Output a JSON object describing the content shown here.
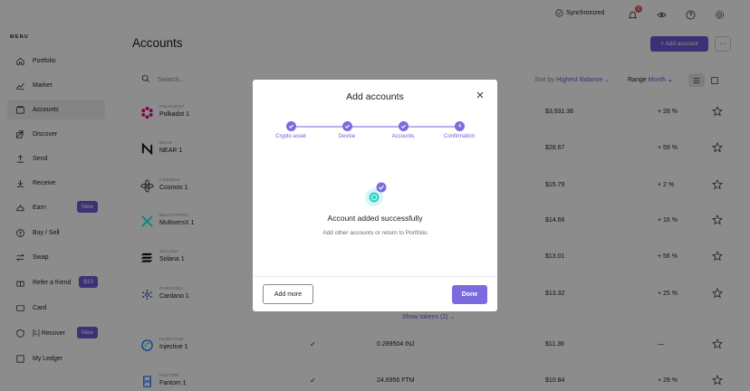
{
  "sidebar": {
    "menu_label": "MENU",
    "items": [
      {
        "label": "Portfolio",
        "icon": "portfolio-icon"
      },
      {
        "label": "Market",
        "icon": "market-icon"
      },
      {
        "label": "Accounts",
        "icon": "accounts-icon",
        "active": true
      },
      {
        "label": "Discover",
        "icon": "discover-icon"
      },
      {
        "label": "Send",
        "icon": "send-icon"
      },
      {
        "label": "Receive",
        "icon": "receive-icon"
      },
      {
        "label": "Earn",
        "icon": "earn-icon",
        "badge": "New"
      },
      {
        "label": "Buy / Sell",
        "icon": "buy-sell-icon"
      },
      {
        "label": "Swap",
        "icon": "swap-icon"
      },
      {
        "label": "Refer a friend",
        "icon": "refer-icon",
        "badge": "$10"
      },
      {
        "label": "Card",
        "icon": "card-icon"
      },
      {
        "label": "[L] Recover",
        "icon": "recover-icon",
        "badge": "New"
      },
      {
        "label": "My Ledger",
        "icon": "ledger-icon"
      }
    ]
  },
  "topbar": {
    "sync_label": "Synchronized",
    "notification_count": "1"
  },
  "main": {
    "title": "Accounts",
    "add_account_label": "+ Add account",
    "more_label": "···",
    "search_placeholder": "Search...",
    "sort_label": "Sort by",
    "sort_value": "Highest Balance",
    "range_label": "Range",
    "range_value": "Month",
    "show_tokens_label": "Show tokens (2) ⌄"
  },
  "accounts": [
    {
      "network": "POLKADOT",
      "name": "Polkadot 1",
      "fiat": "$3,931.36",
      "change": "+ 28 %",
      "check": "",
      "balance": ""
    },
    {
      "network": "NEAR",
      "name": "NEAR 1",
      "fiat": "$28.67",
      "change": "+ 59 %",
      "check": "",
      "balance": ""
    },
    {
      "network": "COSMOS",
      "name": "Cosmos 1",
      "fiat": "$15.79",
      "change": "+ 2 %",
      "check": "",
      "balance": ""
    },
    {
      "network": "MULTIVERSX",
      "name": "MultiversX 1",
      "fiat": "$14.66",
      "change": "+ 16 %",
      "check": "",
      "balance": ""
    },
    {
      "network": "SOLANA",
      "name": "Solana 1",
      "fiat": "$13.01",
      "change": "+ 56 %",
      "check": "",
      "balance": ""
    },
    {
      "network": "CARDANO",
      "name": "Cardano 1",
      "fiat": "$13.32",
      "change": "+ 25 %",
      "check": "",
      "balance": ""
    },
    {
      "network": "INJECTIVE",
      "name": "Injective 1",
      "fiat": "$11.36",
      "change": "—",
      "check": "✓",
      "balance": "0.289504 INJ"
    },
    {
      "network": "FANTOM",
      "name": "Fantom 1",
      "fiat": "$10.84",
      "change": "+ 29 %",
      "check": "✓",
      "balance": "24.6956 FTM"
    }
  ],
  "modal": {
    "title": "Add accounts",
    "steps": [
      "Crypto asset",
      "Device",
      "Accounts",
      "Confirmation"
    ],
    "current_step_number": "4",
    "success_title": "Account added successfully",
    "success_subtitle": "Add other accounts or return to Portfolio",
    "add_more_label": "Add more",
    "done_label": "Done"
  },
  "colors": {
    "accent": "#6c5bd6",
    "overlay": "rgba(0,0,0,0.45)"
  }
}
